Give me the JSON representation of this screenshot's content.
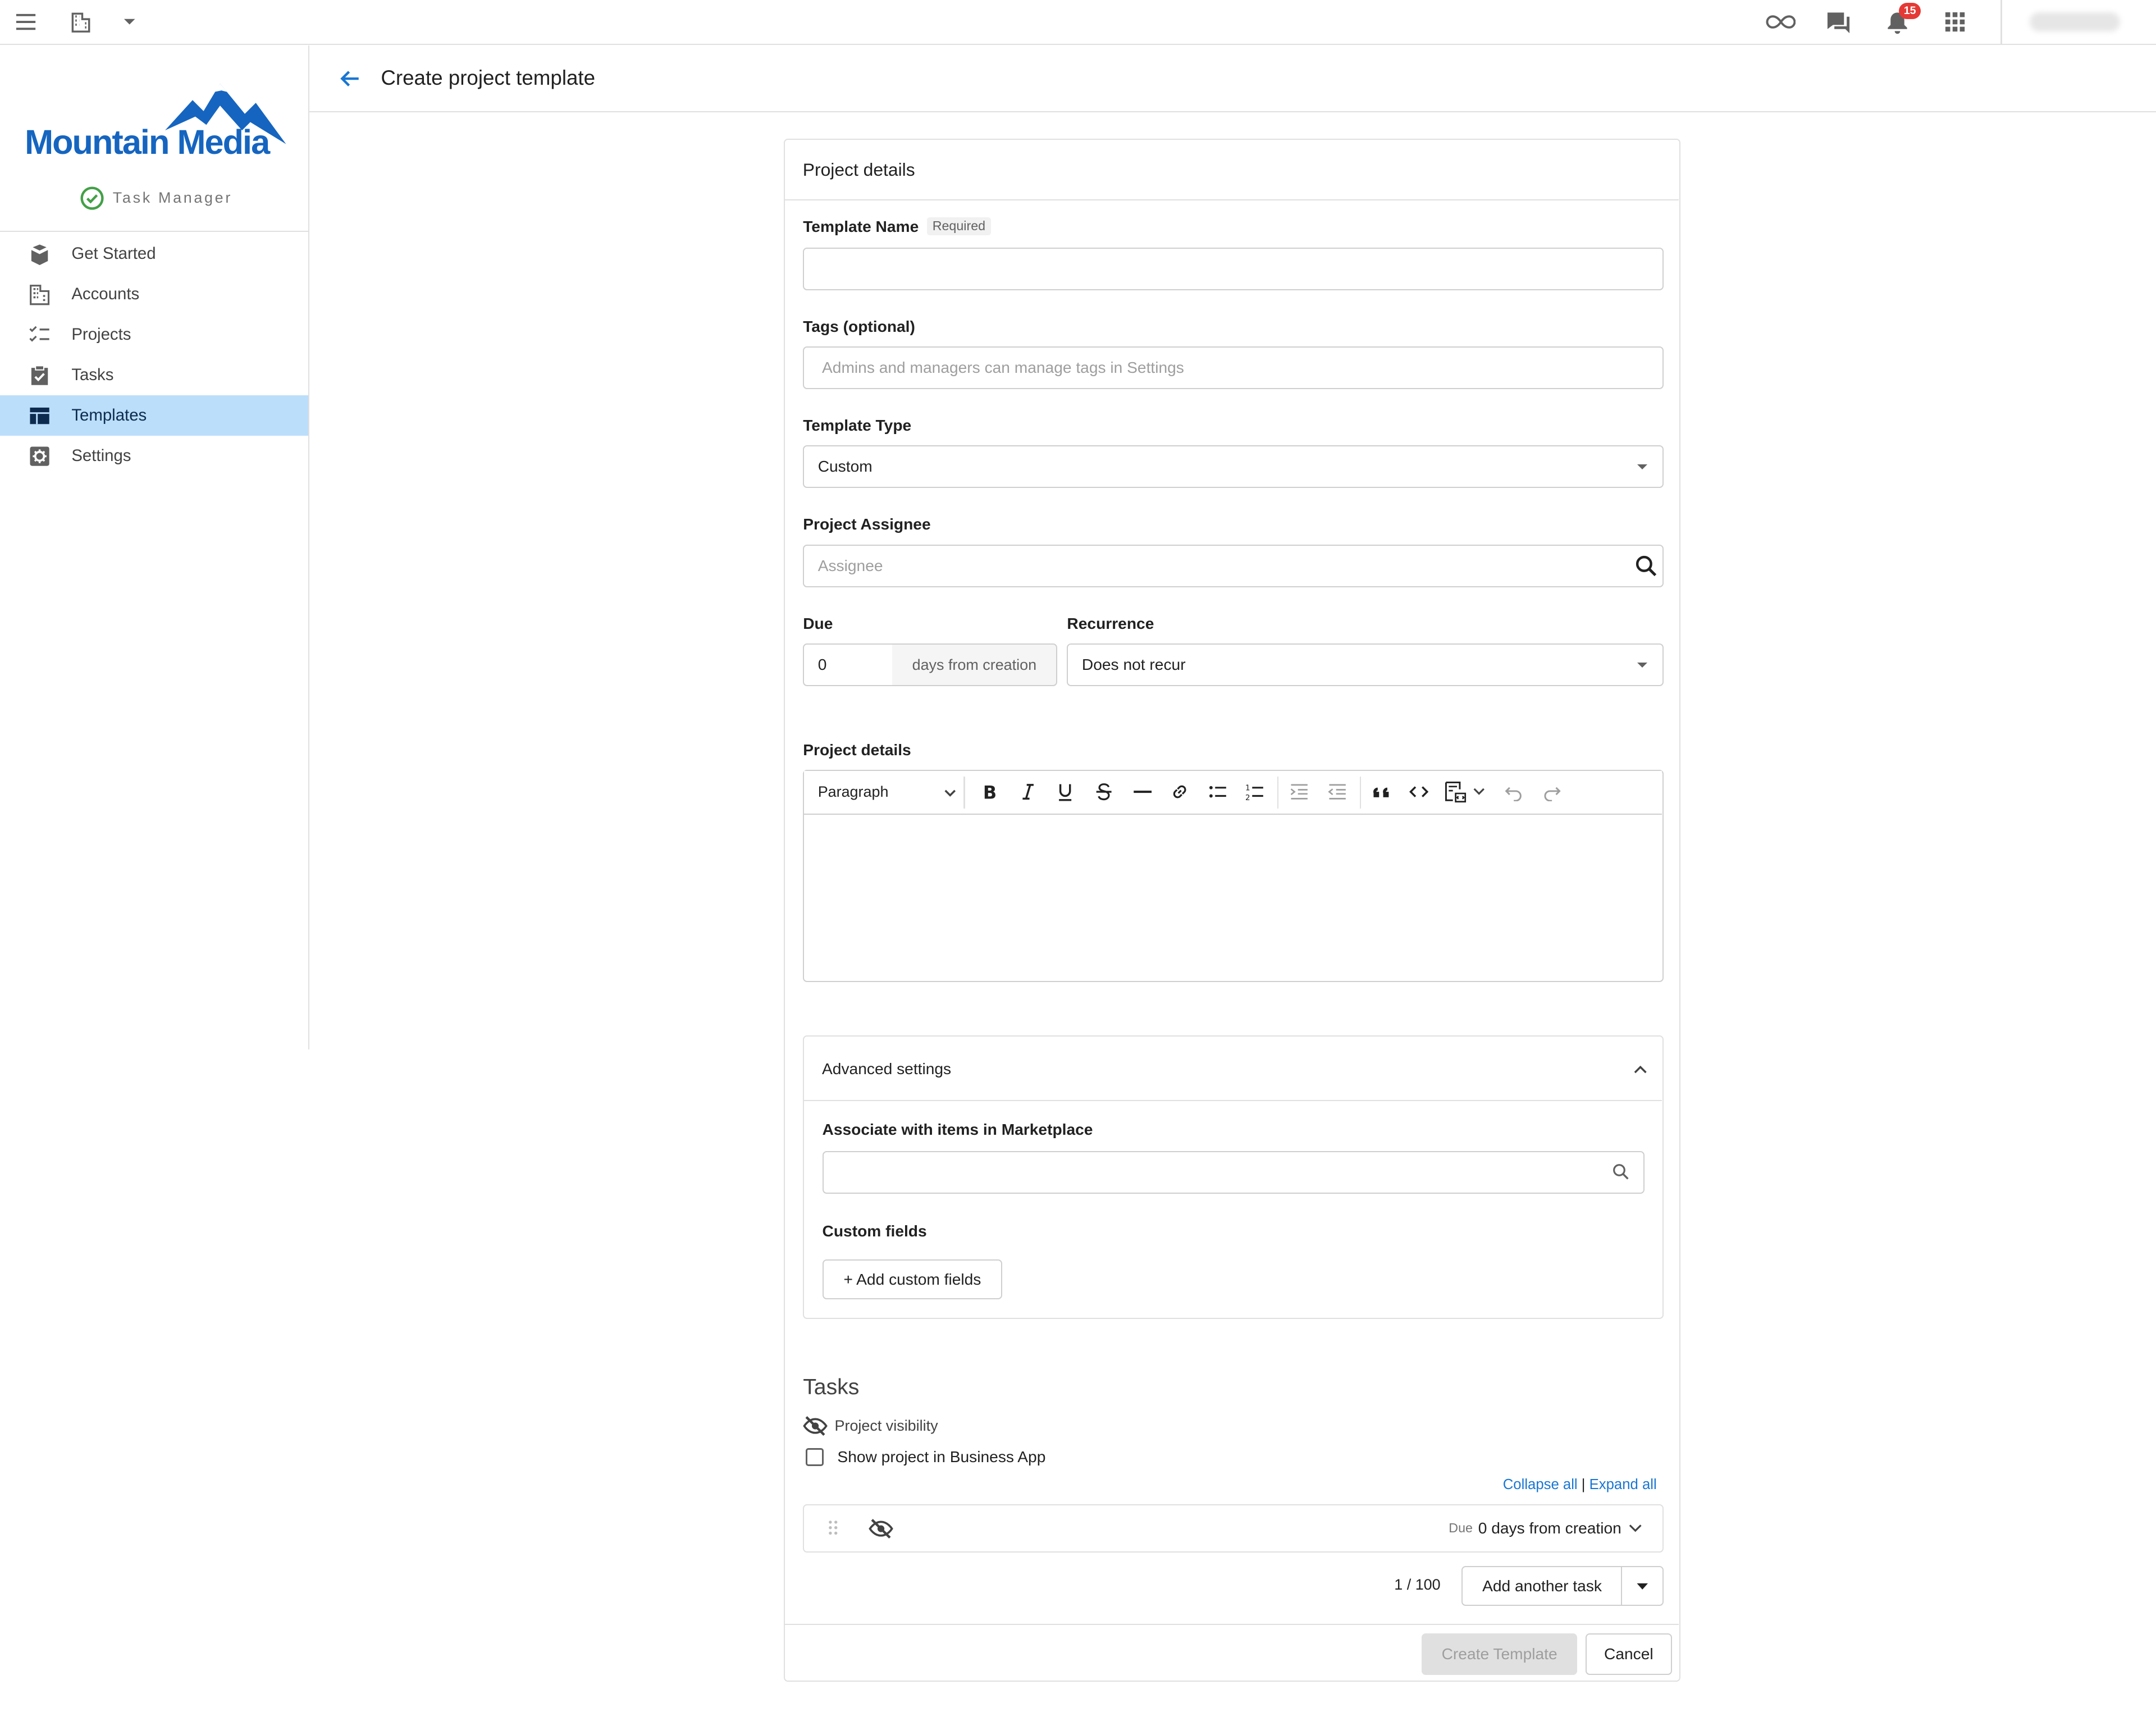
{
  "topbar": {
    "notification_count": "15",
    "icons": [
      "menu-icon",
      "building-icon",
      "caret-down-icon",
      "infinity-icon",
      "chat-icon",
      "bell-icon",
      "apps-grid-icon"
    ]
  },
  "brand": {
    "name": "Mountain Media",
    "product": "Task Manager",
    "color": "#1565c0"
  },
  "sidebar": {
    "items": [
      {
        "label": "Get Started",
        "icon": "box-icon"
      },
      {
        "label": "Accounts",
        "icon": "building-icon"
      },
      {
        "label": "Projects",
        "icon": "checklist-icon"
      },
      {
        "label": "Tasks",
        "icon": "clipboard-check-icon"
      },
      {
        "label": "Templates",
        "icon": "templates-icon",
        "active": true
      },
      {
        "label": "Settings",
        "icon": "gear-icon"
      }
    ],
    "active_color": "#bbdefb"
  },
  "page": {
    "title": "Create project template"
  },
  "form": {
    "section_title": "Project details",
    "template_name": {
      "label": "Template Name",
      "required_badge": "Required",
      "value": ""
    },
    "tags": {
      "label": "Tags (optional)",
      "placeholder": "Admins and managers can manage tags in Settings"
    },
    "template_type": {
      "label": "Template Type",
      "value": "Custom"
    },
    "assignee": {
      "label": "Project Assignee",
      "placeholder": "Assignee"
    },
    "due": {
      "label": "Due",
      "value": "0",
      "suffix": "days from creation"
    },
    "recurrence": {
      "label": "Recurrence",
      "value": "Does not recur"
    },
    "details": {
      "label": "Project details",
      "block_format": "Paragraph"
    }
  },
  "advanced": {
    "title": "Advanced settings",
    "marketplace_label": "Associate with items in Marketplace",
    "custom_fields_label": "Custom fields",
    "add_custom_fields": "+ Add custom fields"
  },
  "tasks": {
    "heading": "Tasks",
    "visibility_label": "Project visibility",
    "show_in_app": "Show project in Business App",
    "collapse_all": "Collapse all",
    "separator": "|",
    "expand_all": "Expand all",
    "row": {
      "due_prefix": "Due",
      "due_value": "0 days from creation"
    },
    "count": "1 / 100",
    "add_another": "Add another task"
  },
  "footer": {
    "create": "Create Template",
    "cancel": "Cancel"
  }
}
